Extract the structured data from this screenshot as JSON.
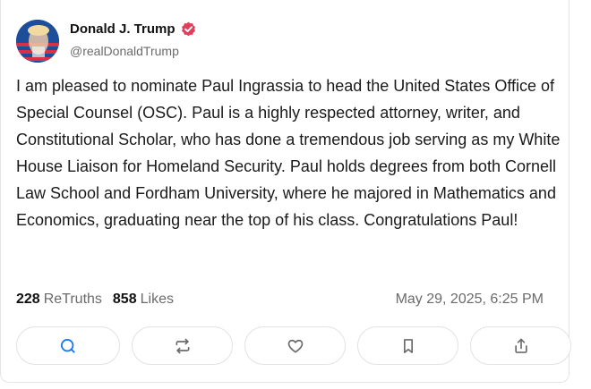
{
  "post": {
    "author_name": "Donald J. Trump",
    "author_handle": "@realDonaldTrump",
    "avatar_icon": "avatar-image",
    "verified_icon": "verified-badge-icon",
    "verified_color": "#e03e5a",
    "text": "I am pleased to nominate Paul Ingrassia to head the United States Office of Special Counsel (OSC). Paul is a highly respected attorney, writer, and Constitutional Scholar, who has done a tremendous job serving as my White House Liaison for Homeland Security. Paul holds degrees from both Cornell Law School and Fordham University, where he majored in Mathematics and Economics, graduating near the top of his class. Congratulations Paul!",
    "retruths_count": "228",
    "retruths_label": "ReTruths",
    "likes_count": "858",
    "likes_label": "Likes",
    "timestamp": "May 29, 2025, 6:25 PM"
  },
  "actions": [
    {
      "name": "reply",
      "icon": "reply-bubble-icon",
      "color": "#1877f2"
    },
    {
      "name": "retruth",
      "icon": "retruth-icon",
      "color": "#6b6b6b"
    },
    {
      "name": "like",
      "icon": "heart-icon",
      "color": "#6b6b6b"
    },
    {
      "name": "bookmark",
      "icon": "bookmark-icon",
      "color": "#6b6b6b"
    },
    {
      "name": "share",
      "icon": "share-icon",
      "color": "#6b6b6b"
    }
  ]
}
